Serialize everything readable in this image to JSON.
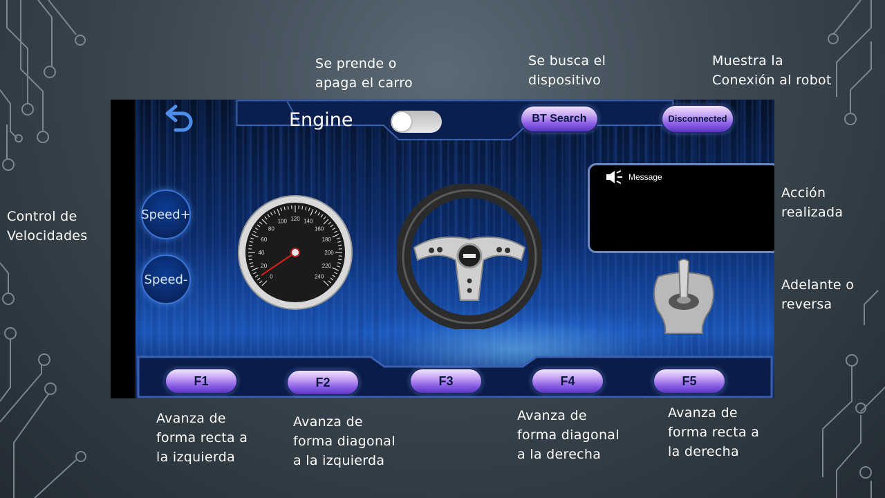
{
  "app": {
    "engine_label": "Engine",
    "engine_on": false,
    "bt_search_label": "BT Search",
    "connection_label": "Disconnected",
    "speed_up_label": "Speed+",
    "speed_down_label": "Speed-",
    "message_label": "Message",
    "speedometer": {
      "ticks": [
        "0",
        "20",
        "40",
        "60",
        "80",
        "100",
        "120",
        "140",
        "160",
        "180",
        "200",
        "220",
        "240"
      ],
      "needle_value": 0
    },
    "function_buttons": [
      "F1",
      "F2",
      "F3",
      "F4",
      "F5"
    ]
  },
  "annotations": {
    "engine": "Se prende o\napaga el carro",
    "bt_search": "Se busca el\ndispositivo",
    "connection": "Muestra la\nConexión al robot",
    "speed": "Control de\nVelocidades",
    "message": "Acción\nrealizada",
    "lever": "Adelante o\nreversa",
    "f1": "Avanza de\nforma recta a\nla izquierda",
    "f2": "Avanza de\nforma diagonal\na la izquierda",
    "f4": "Avanza de\nforma diagonal\na la derecha",
    "f5": "Avanza de\nforma recta a\nla derecha"
  },
  "colors": {
    "background": "#3c4852",
    "panel_blue": "#0b2a66",
    "pill_purple": "#8a5fe6",
    "bar_outline": "#3a5fb0"
  }
}
